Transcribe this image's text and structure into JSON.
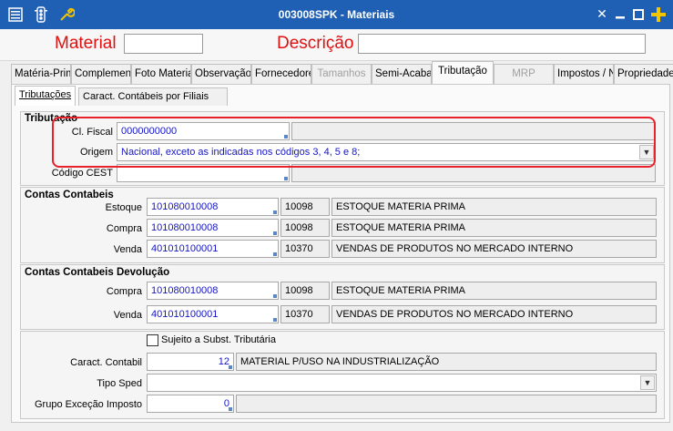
{
  "window": {
    "title": "003008SPK - Materiais"
  },
  "header": {
    "material_label": "Material",
    "descricao_label": "Descrição",
    "material_value": "",
    "descricao_value": ""
  },
  "tabs": [
    {
      "label": "Matéria-Prim"
    },
    {
      "label": "Complemento"
    },
    {
      "label": "Foto Materia"
    },
    {
      "label": "Observação"
    },
    {
      "label": "Fornecedore"
    },
    {
      "label": "Tamanhos"
    },
    {
      "label": "Semi-Acabac"
    },
    {
      "label": "Tributação"
    },
    {
      "label": "MRP"
    },
    {
      "label": "Impostos / N"
    },
    {
      "label": "Propriedades"
    }
  ],
  "subtabs": [
    {
      "label": "Tributações"
    },
    {
      "label": "Caract. Contábeis por Filiais"
    }
  ],
  "tributacao": {
    "title": "Tributação",
    "cl_fiscal_label": "Cl. Fiscal",
    "cl_fiscal_value": "0000000000",
    "origem_label": "Origem",
    "origem_value": "Nacional, exceto as indicadas nos códigos 3, 4, 5 e 8;",
    "cest_label": "Código CEST",
    "cest_value": ""
  },
  "contas": {
    "title": "Contas Contabeis",
    "rows": [
      {
        "label": "Estoque",
        "account": "101080010008",
        "code": "10098",
        "desc": "ESTOQUE MATERIA PRIMA"
      },
      {
        "label": "Compra",
        "account": "101080010008",
        "code": "10098",
        "desc": "ESTOQUE MATERIA PRIMA"
      },
      {
        "label": "Venda",
        "account": "401010100001",
        "code": "10370",
        "desc": "VENDAS DE PRODUTOS NO MERCADO INTERNO"
      }
    ]
  },
  "devolucao": {
    "title": "Contas Contabeis Devolução",
    "rows": [
      {
        "label": "Compra",
        "account": "101080010008",
        "code": "10098",
        "desc": "ESTOQUE MATERIA PRIMA"
      },
      {
        "label": "Venda",
        "account": "401010100001",
        "code": "10370",
        "desc": "VENDAS DE PRODUTOS NO MERCADO INTERNO"
      }
    ]
  },
  "outros": {
    "sujeito_label": "Sujeito a Subst. Tributária",
    "sujeito_checked": false,
    "caract_label": "Caract. Contabil",
    "caract_value": "12",
    "caract_desc": "MATERIAL P/USO NA INDUSTRIALIZAÇÃO",
    "tipo_sped_label": "Tipo Sped",
    "tipo_sped_value": "",
    "grupo_label": "Grupo Exceção Imposto",
    "grupo_value": "0",
    "grupo_desc": ""
  },
  "icons": {
    "window_menu": "window-menu-icon",
    "traffic_light": "traffic-light-icon",
    "wrench": "wrench-icon",
    "close": "close-icon",
    "minimize": "minimize-icon",
    "maximize": "maximize-icon",
    "add": "add-icon"
  },
  "colors": {
    "titlebar": "#1f5fb4",
    "label_red": "#e01010",
    "value_blue": "#1414c8",
    "highlight": "#e8212a",
    "add_yellow": "#f5c400"
  }
}
